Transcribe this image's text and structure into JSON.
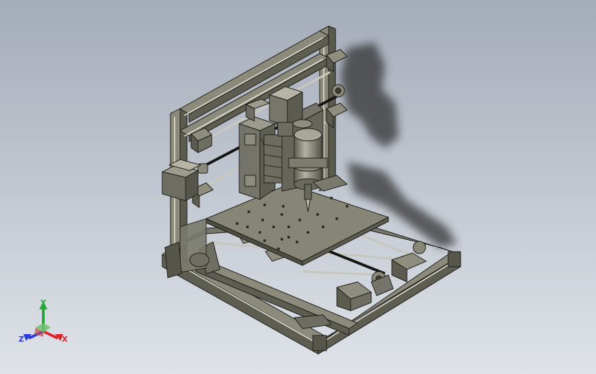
{
  "viewport": {
    "background_top": "#a4acb8",
    "background_bottom": "#dfe3e9",
    "model_color": "#7e7d6e",
    "model_dark": "#4a4a40",
    "model_light": "#a3a292",
    "model_edge": "#1f1f1a"
  },
  "triad": {
    "x_label": "X",
    "y_label": "Y",
    "z_label": "Z",
    "x_color": "#d8262b",
    "y_color": "#25a63a",
    "z_color": "#2a3dd6"
  }
}
